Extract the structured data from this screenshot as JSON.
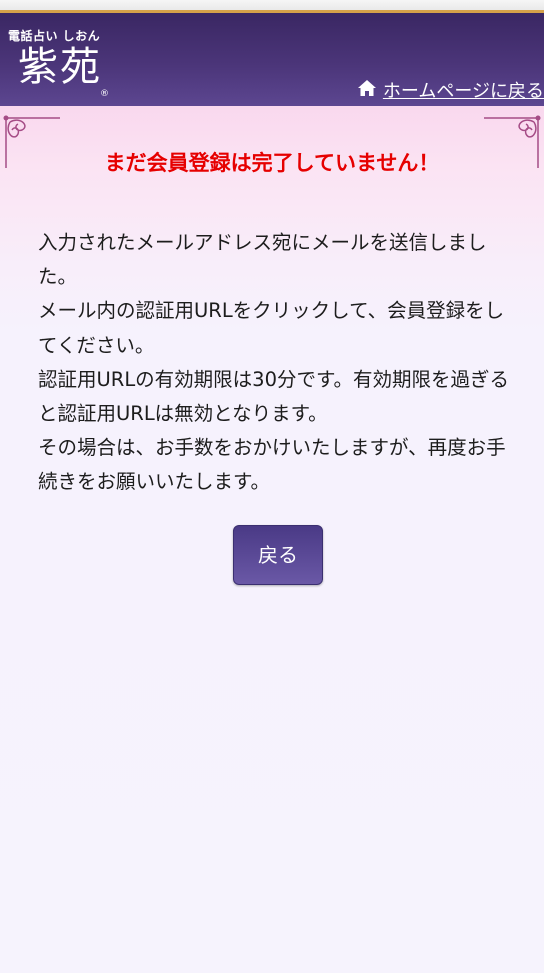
{
  "header": {
    "logo_subtitle": "電話占い しおん",
    "logo_title": "紫苑",
    "logo_mark": "®",
    "home_link": "ホームページに戻る",
    "home_icon": "home-icon"
  },
  "main": {
    "headline": "まだ会員登録は完了していません！",
    "paragraphs": [
      "入力されたメールアドレス宛にメールを送信しました。",
      "メール内の認証用URLをクリックして、会員登録をしてください。",
      "認証用URLの有効期限は30分です。有効期限を過ぎると認証用URLは無効となります。",
      "その場合は、お手数をおかけいたしますが、再度お手続きをお願いいたします。"
    ],
    "back_button": "戻る"
  },
  "colors": {
    "header_bg": "#3a2763",
    "header_border": "#d6a24a",
    "headline": "#e60000",
    "button_bg": "#5a4896",
    "page_bg": "#f6f3fd"
  }
}
